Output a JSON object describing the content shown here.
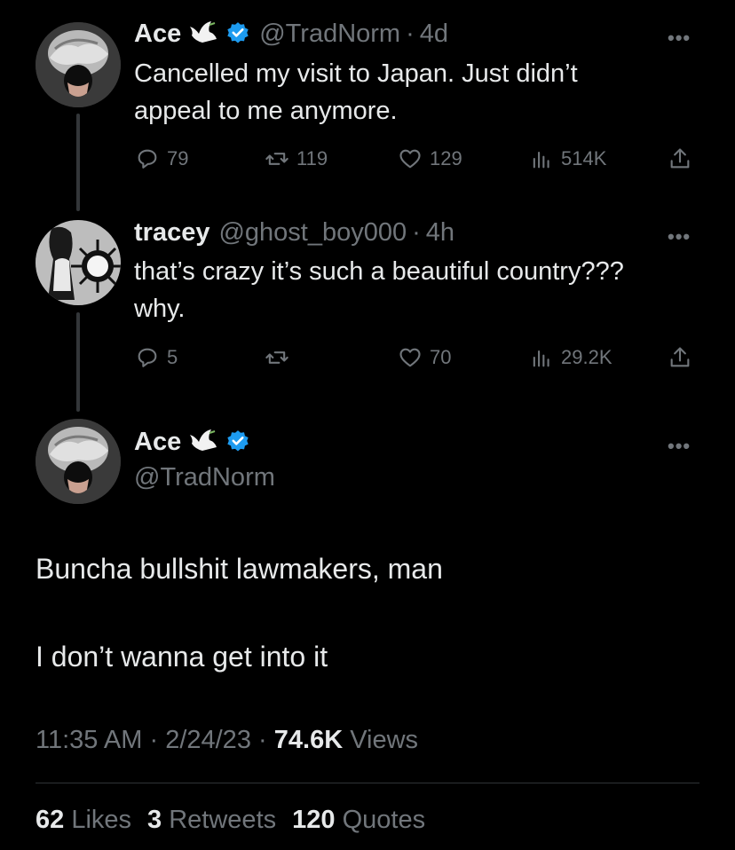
{
  "tweet1": {
    "name": "Ace",
    "handle": "@TradNorm",
    "time": "4d",
    "text": "Cancelled my visit to Japan. Just didn’t\nappeal to me anymore.",
    "replies": "79",
    "retweets": "119",
    "likes": "129",
    "views": "514K",
    "more": "•••"
  },
  "tweet2": {
    "name": "tracey",
    "handle": "@ghost_boy000",
    "time": "4h",
    "text": "that’s crazy it’s such a beautiful country???\nwhy.",
    "replies": "5",
    "retweets": "",
    "likes": "70",
    "views": "29.2K",
    "more": "•••"
  },
  "main": {
    "name": "Ace",
    "handle": "@TradNorm",
    "more": "•••",
    "line1": "Buncha bullshit lawmakers, man",
    "line2": "I don’t wanna get into it",
    "time": "11:35 AM",
    "date": "2/24/23",
    "views_count": "74.6K",
    "views_label": "Views",
    "likes_count": "62",
    "likes_label": "Likes",
    "retweets_count": "3",
    "retweets_label": "Retweets",
    "quotes_count": "120",
    "quotes_label": "Quotes",
    "dot": "·"
  },
  "colors": {
    "background": "#000000",
    "text": "#e7e9ea",
    "muted": "#71767b",
    "verified": "#1d9bf0",
    "thread": "#333639"
  },
  "icons": [
    "reply-icon",
    "retweet-icon",
    "like-icon",
    "views-icon",
    "share-icon",
    "verified-icon",
    "dove-emoji"
  ]
}
